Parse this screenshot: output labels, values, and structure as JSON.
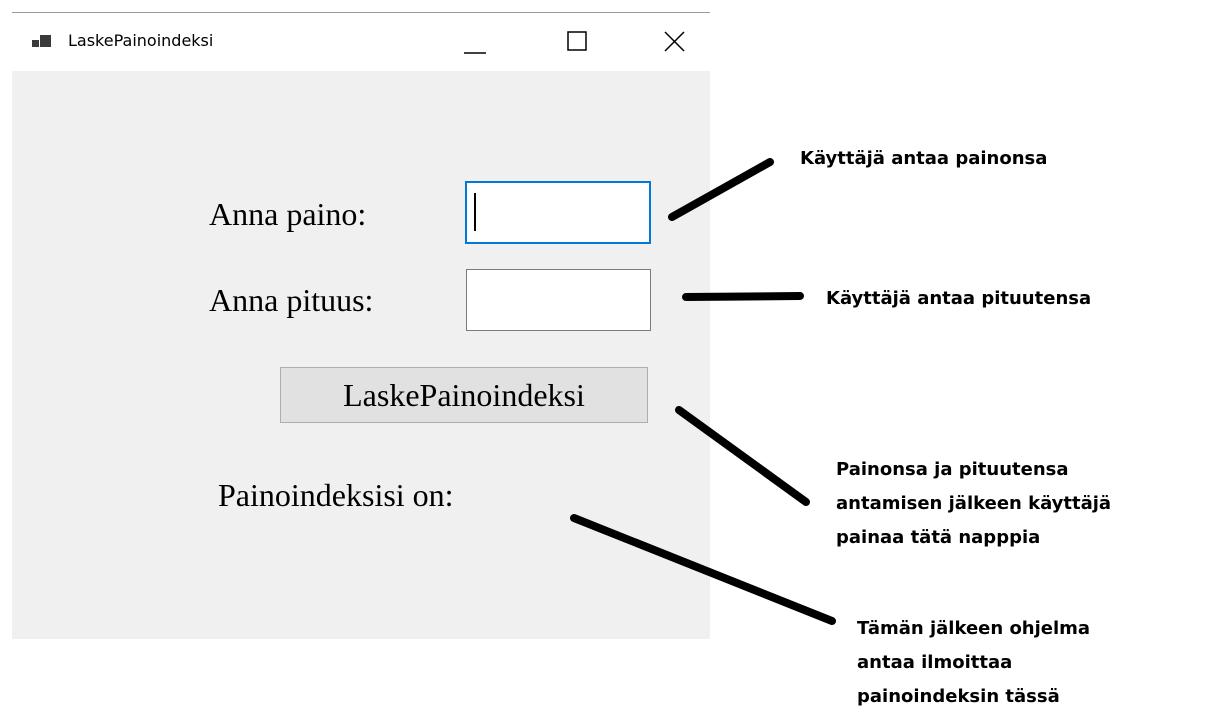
{
  "window": {
    "title": "LaskePainoindeksi",
    "icons": {
      "app": "app-window-icon",
      "minimize": "minimize-icon",
      "maximize": "maximize-icon",
      "close": "close-icon"
    }
  },
  "form": {
    "weight_label": "Anna paino:",
    "weight_value": "",
    "height_label": "Anna pituus:",
    "height_value": "",
    "calculate_button": "LaskePainoindeksi",
    "result_label": "Painoindeksisi on:"
  },
  "annotations": {
    "weight": "Käyttäjä antaa painonsa",
    "height": "Käyttäjä antaa pituutensa",
    "button_lines": [
      "Painonsa ja pituutensa",
      "antamisen jälkeen käyttäjä",
      "painaa tätä napppia"
    ],
    "result_lines": [
      "Tämän jälkeen ohjelma",
      "antaa ilmoittaa",
      "painoindeksin tässä"
    ]
  },
  "colors": {
    "focus_border": "#0078d7",
    "textbox_border": "#7a7a7a",
    "client_background": "#f0f0f0",
    "button_background": "#e1e1e1"
  }
}
